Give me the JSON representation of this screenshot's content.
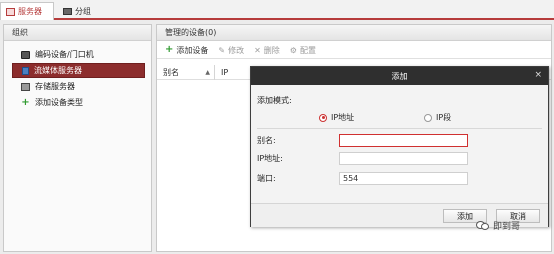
{
  "tabs": [
    {
      "label": "服务器",
      "icon": "server-icon",
      "active": true
    },
    {
      "label": "分组",
      "icon": "group-icon",
      "active": false
    }
  ],
  "left_panel": {
    "title": "组织",
    "items": [
      {
        "label": "编码设备/门口机",
        "icon": "encoder-icon"
      },
      {
        "label": "流媒体服务器",
        "icon": "stream-server-icon",
        "selected": true
      },
      {
        "label": "存储服务器",
        "icon": "storage-server-icon"
      },
      {
        "label": "添加设备类型",
        "icon": "plus-icon"
      }
    ]
  },
  "main_panel": {
    "title": "管理的设备(0)",
    "toolbar": {
      "add": "添加设备",
      "edit": "修改",
      "delete": "删除",
      "config": "配置"
    },
    "columns": {
      "alias": "别名",
      "ip": "IP"
    }
  },
  "dialog": {
    "title": "添加",
    "close_glyph": "×",
    "mode_label": "添加模式:",
    "mode_ip": "IP地址",
    "mode_segment": "IP段",
    "selected_mode": "IP地址",
    "alias_label": "别名:",
    "alias_value": "",
    "ip_label": "IP地址:",
    "ip_value": "",
    "port_label": "端口:",
    "port_value": "554",
    "ok_label": "添加",
    "cancel_label": "取消"
  },
  "watermark": {
    "text": "即到哥"
  },
  "colors": {
    "accent": "#b63c3c",
    "selected_bg": "#8c2d2d",
    "dialog_title_bg": "#2f2f2f"
  }
}
